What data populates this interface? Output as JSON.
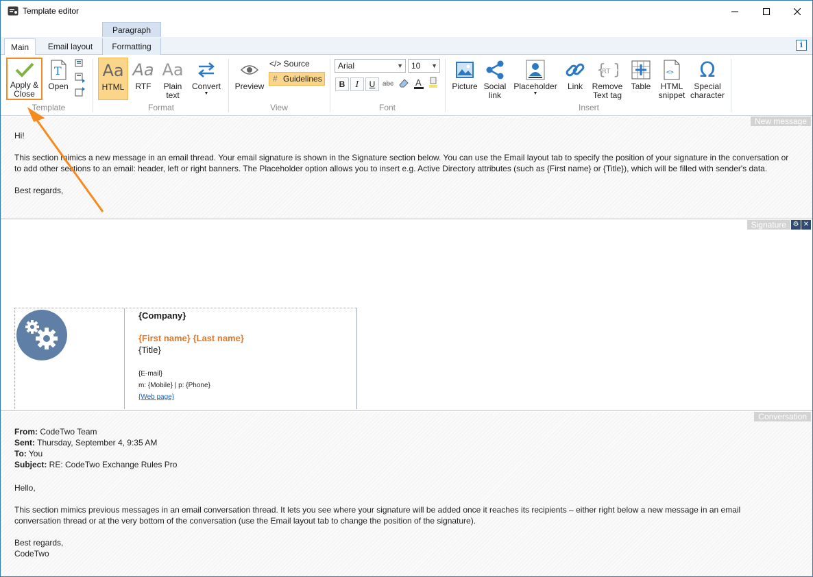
{
  "window": {
    "title": "Template editor"
  },
  "tabs": {
    "context_group": "Paragraph",
    "items": [
      "Main",
      "Email layout",
      "Formatting"
    ],
    "active": "Main"
  },
  "ribbon": {
    "template": {
      "apply_close": "Apply &\nClose",
      "open": "Open",
      "group": "Template"
    },
    "format": {
      "html": "HTML",
      "rtf": "RTF",
      "plain": "Plain\ntext",
      "convert": "Convert",
      "group": "Format"
    },
    "view": {
      "preview": "Preview",
      "source": "</> Source",
      "guidelines": "Guidelines",
      "group": "View"
    },
    "font": {
      "family": "Arial",
      "size": "10",
      "bold": "B",
      "italic": "I",
      "underline": "U",
      "strike": "abc",
      "group": "Font"
    },
    "insert": {
      "picture": "Picture",
      "social_link": "Social\nlink",
      "placeholder": "Placeholder",
      "link": "Link",
      "remove_text_tag": "Remove\nText tag",
      "table": "Table",
      "html_snippet": "HTML\nsnippet",
      "special_character": "Special\ncharacter",
      "group": "Insert"
    }
  },
  "new_message": {
    "label": "New message",
    "greeting": "Hi!",
    "body": "This section mimics a new message in an email thread. Your email signature is shown in the Signature section below. You can use the Email layout tab to specify the position of your signature in the conversation or to add other sections to an email: header, left or right banners. The Placeholder option allows you to insert e.g. Active Directory attributes (such as {First name} or {Title}), which will be filled with sender's data.",
    "closing": "Best regards,"
  },
  "signature": {
    "label": "Signature",
    "company": "{Company}",
    "name": "{First name} {Last name}",
    "title": "{Title}",
    "email": "{E-mail}",
    "phones": "m:  {Mobile} | p: {Phone}",
    "web": "{Web page}"
  },
  "conversation": {
    "label": "Conversation",
    "from_label": "From:",
    "from": " CodeTwo Team",
    "sent_label": "Sent:",
    "sent": " Thursday, September 4, 9:35 AM",
    "to_label": "To:",
    "to": " You",
    "subject_label": "Subject:",
    "subject": " RE: CodeTwo Exchange Rules Pro",
    "greeting": "Hello,",
    "body": "This section mimics previous messages in an email conversation thread. It lets you see where your signature will be added once it reaches its recipients – either right below a new message in an email conversation thread or at the very bottom of the conversation (use the Email layout tab to change the position of the signature).",
    "closing1": "Best regards,",
    "closing2": "CodeTwo"
  },
  "colors": {
    "accent": "#2b78c5",
    "highlight": "#fbd68a",
    "name_orange": "#e2792a",
    "annotation_arrow": "#f58a1f"
  }
}
